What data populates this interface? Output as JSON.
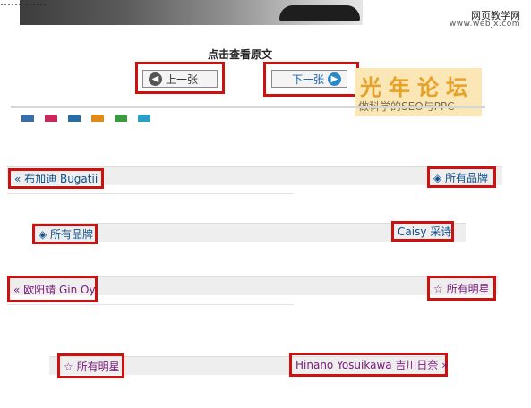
{
  "header": {
    "top_cut_text": "…… ……"
  },
  "watermark": {
    "site_name": "网页教学网",
    "site_url": "www.webjx.com"
  },
  "viewer": {
    "view_original_label": "点击查看原文",
    "prev_label": "上一张",
    "next_label": "下一张"
  },
  "logo": {
    "title": "光年论坛",
    "subtitle": "做科学的SEO与PPC"
  },
  "share_icons": [
    {
      "name": "share-icon-1",
      "color": "#3b6ea8"
    },
    {
      "name": "share-icon-2",
      "color": "#c9285d"
    },
    {
      "name": "share-icon-3",
      "color": "#2a6ea0"
    },
    {
      "name": "share-icon-4",
      "color": "#e08a1a"
    },
    {
      "name": "share-icon-5",
      "color": "#3c9c3c"
    },
    {
      "name": "share-icon-6",
      "color": "#2aa0c8"
    }
  ],
  "nav_rows": [
    {
      "left": "« 布加迪 Bugatii",
      "right": "◈ 所有品牌"
    },
    {
      "left": "◈ 所有品牌",
      "right": "Caisy 采诗"
    },
    {
      "left": "« 欧阳靖 Gin Oy",
      "right": "☆ 所有明星"
    },
    {
      "left": "☆ 所有明星",
      "right": "Hinano Yosuikawa 吉川日奈 »"
    }
  ],
  "colors": {
    "highlight_border": "#cc1111",
    "link_blue": "#0e4f8a",
    "link_purple": "#7a1a7a",
    "bar_bg": "#eeeeee"
  }
}
